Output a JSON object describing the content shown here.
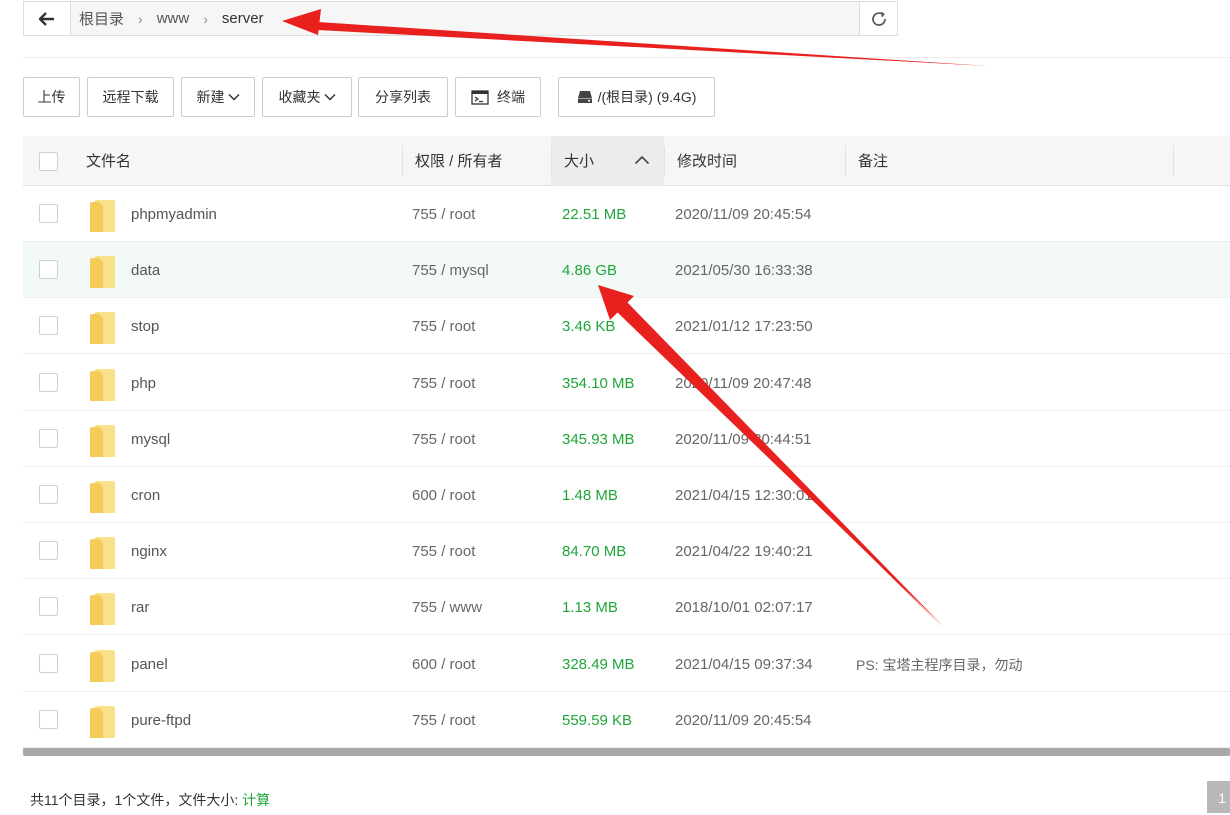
{
  "pathbar": {
    "crumbs": [
      "根目录",
      "www",
      "server"
    ]
  },
  "toolbar": {
    "upload": "上传",
    "remote_download": "远程下载",
    "new": "新建",
    "favorites": "收藏夹",
    "share_list": "分享列表",
    "terminal": "终端",
    "disk": "/(根目录) (9.4G)"
  },
  "table": {
    "headers": {
      "name": "文件名",
      "perm": "权限 / 所有者",
      "size": "大小",
      "mtime": "修改时间",
      "note": "备注"
    },
    "sort_column": "size",
    "rows": [
      {
        "name": "phpmyadmin",
        "perm": "755 / root",
        "size": "22.51 MB",
        "mtime": "2020/11/09 20:45:54",
        "note": ""
      },
      {
        "name": "data",
        "perm": "755 / mysql",
        "size": "4.86 GB",
        "mtime": "2021/05/30 16:33:38",
        "note": ""
      },
      {
        "name": "stop",
        "perm": "755 / root",
        "size": "3.46 KB",
        "mtime": "2021/01/12 17:23:50",
        "note": ""
      },
      {
        "name": "php",
        "perm": "755 / root",
        "size": "354.10 MB",
        "mtime": "2020/11/09 20:47:48",
        "note": ""
      },
      {
        "name": "mysql",
        "perm": "755 / root",
        "size": "345.93 MB",
        "mtime": "2020/11/09 20:44:51",
        "note": ""
      },
      {
        "name": "cron",
        "perm": "600 / root",
        "size": "1.48 MB",
        "mtime": "2021/04/15 12:30:01",
        "note": ""
      },
      {
        "name": "nginx",
        "perm": "755 / root",
        "size": "84.70 MB",
        "mtime": "2021/04/22 19:40:21",
        "note": ""
      },
      {
        "name": "rar",
        "perm": "755 / www",
        "size": "1.13 MB",
        "mtime": "2018/10/01 02:07:17",
        "note": ""
      },
      {
        "name": "panel",
        "perm": "600 / root",
        "size": "328.49 MB",
        "mtime": "2021/04/15 09:37:34",
        "note": "PS: 宝塔主程序目录，勿动"
      },
      {
        "name": "pure-ftpd",
        "perm": "755 / root",
        "size": "559.59 KB",
        "mtime": "2020/11/09 20:45:54",
        "note": ""
      }
    ]
  },
  "footer": {
    "summary": "共11个目录，1个文件，文件大小:",
    "calc_link": "计算",
    "page": "1"
  },
  "colors": {
    "accent_green": "#20a53a",
    "folder_yellow": "#f7d26a",
    "annotation_red": "#e8211f",
    "row_hover": "#f2f9f6"
  }
}
